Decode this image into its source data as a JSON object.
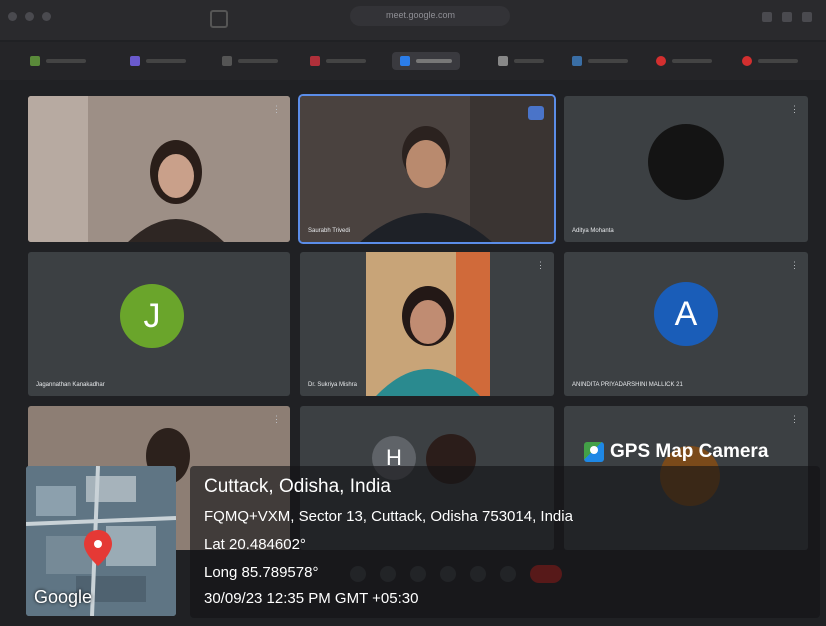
{
  "browser": {
    "url": "meet.google.com"
  },
  "meeting": {
    "participants": [
      {
        "name": ""
      },
      {
        "name": "Saurabh Trivedi"
      },
      {
        "name": "Aditya Mohanta"
      },
      {
        "name": "Jagannathan Kanakadhar",
        "initial": "J"
      },
      {
        "name": "Dr. Sukriya Mishra"
      },
      {
        "name": "ANINDITA PRIYADARSHINI MALLICK 21",
        "initial": "A"
      },
      {
        "name": ""
      },
      {
        "name": "",
        "initial": "H"
      },
      {
        "name": ""
      }
    ]
  },
  "overlay": {
    "brand": "GPS Map Camera",
    "location_title": "Cuttack, Odisha, India",
    "address": "FQMQ+VXM, Sector 13, Cuttack, Odisha 753014, India",
    "lat": "Lat 20.484602°",
    "long": "Long 85.789578°",
    "datetime": "30/09/23 12:35 PM GMT +05:30",
    "map_label": "Google"
  },
  "colors": {
    "tile_bg": "#3c4043",
    "avatar_j": "#6aa52b",
    "avatar_a": "#1a5db8",
    "avatar_h": "#5f6368",
    "speaking_outline": "#5b8de8",
    "end_call": "#c5221f"
  }
}
